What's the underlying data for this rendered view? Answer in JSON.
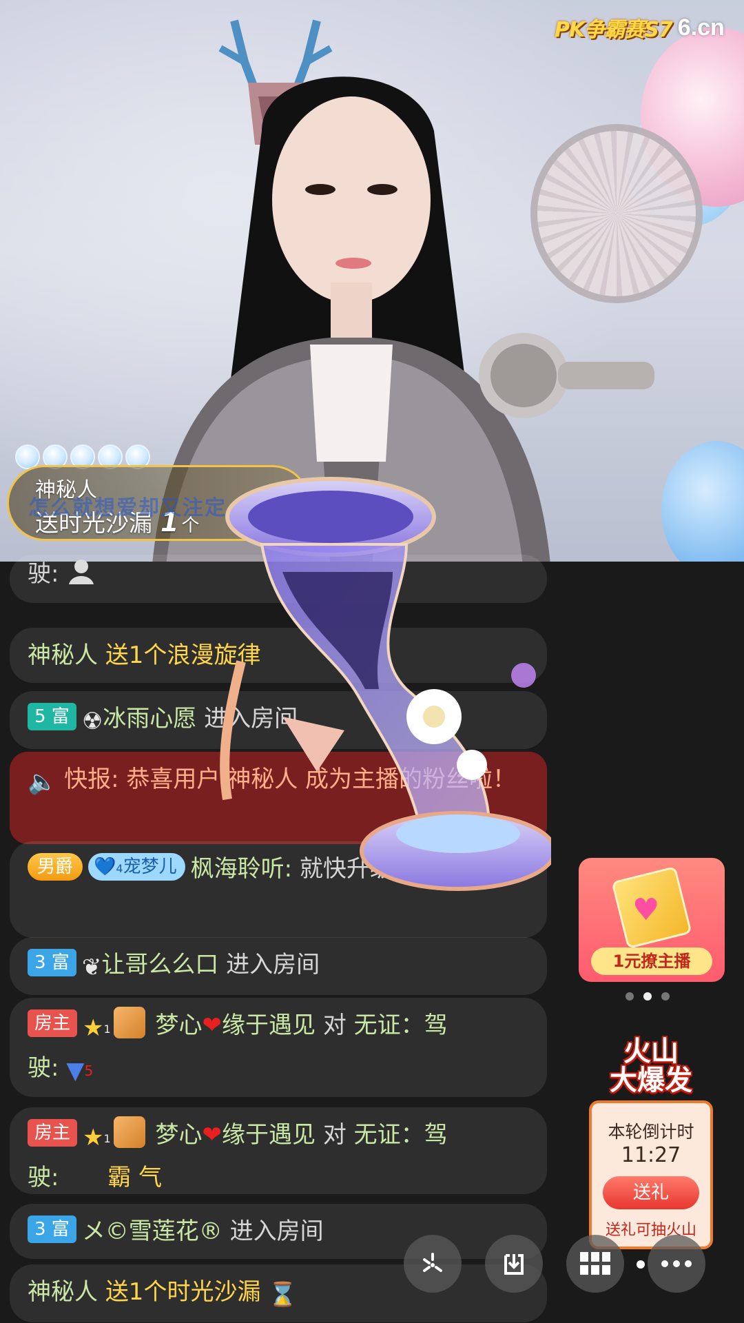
{
  "watermark": {
    "pk_label": "PK争霸赛S7",
    "site": "6.cn"
  },
  "gift_toast": {
    "ghost_text": "怎么就想爱却又注定",
    "sender": "神秘人",
    "action": "送时光沙漏",
    "count": "1",
    "unit": "个"
  },
  "chat": {
    "row0": {
      "text": "驶:"
    },
    "row1": {
      "user": "神秘人",
      "message": "送1个浪漫旋律"
    },
    "row2": {
      "badge": "5 富",
      "user": "冰雨心愿",
      "action": "进入房间"
    },
    "row3": {
      "message": "快报: 恭喜用户 神秘人 成为主播的粉丝啦！"
    },
    "row4": {
      "badge_title": "男爵",
      "fan_level": "4",
      "fan_name": "宠梦儿",
      "user": "枫海聆听:",
      "message": "就快升级了粉丝牌"
    },
    "row5": {
      "badge": "3 富",
      "user": "让哥么么口",
      "action": "进入房间"
    },
    "row6": {
      "badge": "房主",
      "level": "1",
      "user": "梦心",
      "user2": "缘于遇见",
      "conj": "对",
      "target": "无证：驾",
      "tail": "驶:",
      "tail_level": "5"
    },
    "row7": {
      "badge": "房主",
      "level": "1",
      "user": "梦心",
      "user2": "缘于遇见",
      "conj": "对",
      "target": "无证：驾",
      "tail": "驶:",
      "tail_text": "霸 气"
    },
    "row8": {
      "badge": "3 富",
      "user": "メ©雪莲花®",
      "action": "进入房间"
    },
    "row9": {
      "user": "神秘人",
      "message": "送1个时光沙漏"
    }
  },
  "promo_card": {
    "label": "1元撩主播"
  },
  "volcano": {
    "title_line1": "火山",
    "title_line2": "大爆发",
    "countdown_label": "本轮倒计时",
    "countdown_time": "11:27",
    "send_label": "送礼",
    "tip": "送礼可抽火山"
  },
  "toolbar": {
    "buttons": [
      "share-icon",
      "download-icon",
      "apps-grid-icon",
      "more-icon"
    ]
  },
  "colors": {
    "chat_name": "#c9e7a5",
    "chat_gift": "#ffd54a",
    "alert_bg": "#7a1f1f"
  }
}
